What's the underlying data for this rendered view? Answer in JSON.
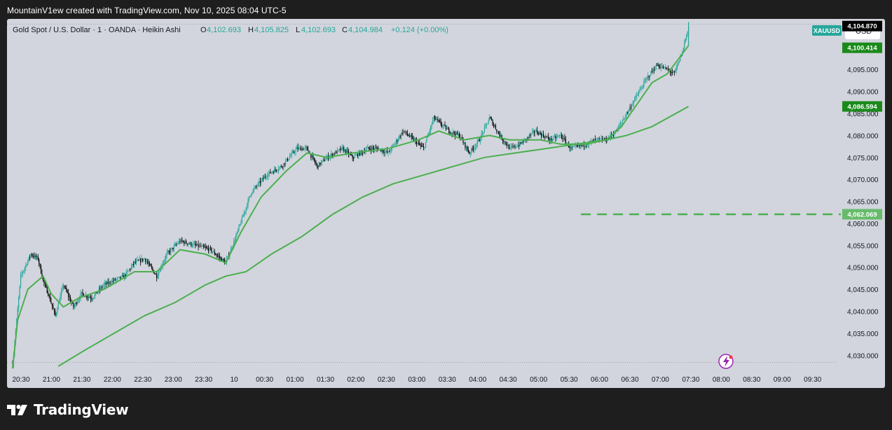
{
  "caption": "MountainV1ew created with TradingView.com, Nov 10, 2025 08:04 UTC-5",
  "brand": {
    "name": "TradingView",
    "icon": "tradingview-logo-icon"
  },
  "colors": {
    "background": "#1e1e1e",
    "plot": "#d2d5dd",
    "up": "#26a69a",
    "down": "#000000",
    "ma_fast": "#4caf50",
    "ma_slow": "#4caf50",
    "dashed_line": "#4caf50",
    "last_price_label": "#000000",
    "ma_label": "#1b8a1b",
    "dashed_label": "#66bb6a",
    "symbol_badge": "#26a69a"
  },
  "chart_data": {
    "type": "candlestick",
    "title": "Gold Spot / U.S. Dollar · 1 · OANDA · Heikin Ashi",
    "symbol": "XAUUSD",
    "currency": "USD",
    "ohlc": {
      "O": "4,102.693",
      "H": "4,105.825",
      "L": "4,102.693",
      "C": "4,104.984",
      "change": "+0.124 (+0.00%)"
    },
    "x_tick_labels": [
      "20:30",
      "21:00",
      "21:30",
      "22:00",
      "22:30",
      "23:00",
      "23:30",
      "10",
      "00:30",
      "01:00",
      "01:30",
      "02:00",
      "02:30",
      "03:00",
      "03:30",
      "04:00",
      "04:30",
      "05:00",
      "05:30",
      "06:00",
      "06:30",
      "07:00",
      "07:30",
      "08:00",
      "08:30",
      "09:00",
      "09:30"
    ],
    "y_tick_labels": [
      "4,095.000",
      "4,090.000",
      "4,085.000",
      "4,080.000",
      "4,075.000",
      "4,070.000",
      "4,065.000",
      "4,060.000",
      "4,055.000",
      "4,050.000",
      "4,045.000",
      "4,040.000",
      "4,035.000",
      "4,030.000"
    ],
    "ylim": [
      4027.5,
      4106.5
    ],
    "price_labels": [
      {
        "value": 4104.87,
        "text": "4,104.870",
        "kind": "last_price"
      },
      {
        "value": 4100.414,
        "text": "4,100.414",
        "kind": "ma_fast"
      },
      {
        "value": 4086.594,
        "text": "4,086.594",
        "kind": "ma_slow"
      },
      {
        "value": 4062.069,
        "text": "4,062.069",
        "kind": "dashed_line"
      }
    ],
    "dashed_line": {
      "value": 4062.069,
      "from_time": "05:50"
    },
    "price_path": [
      [
        "20:30",
        4028
      ],
      [
        "20:38",
        4048
      ],
      [
        "20:48",
        4053
      ],
      [
        "20:55",
        4052
      ],
      [
        "21:00",
        4047
      ],
      [
        "21:05",
        4044
      ],
      [
        "21:12",
        4039
      ],
      [
        "21:20",
        4046
      ],
      [
        "21:30",
        4041
      ],
      [
        "21:38",
        4044
      ],
      [
        "21:48",
        4043
      ],
      [
        "22:00",
        4046
      ],
      [
        "22:10",
        4047
      ],
      [
        "22:20",
        4048
      ],
      [
        "22:30",
        4051
      ],
      [
        "22:40",
        4052
      ],
      [
        "22:52",
        4048
      ],
      [
        "23:02",
        4053
      ],
      [
        "23:15",
        4056
      ],
      [
        "23:30",
        4055
      ],
      [
        "23:45",
        4054
      ],
      [
        "23:55",
        4052
      ],
      [
        "24:00",
        4051
      ],
      [
        "24:10",
        4057
      ],
      [
        "24:25",
        4067
      ],
      [
        "24:40",
        4071
      ],
      [
        "24:55",
        4073
      ],
      [
        "25:10",
        4077
      ],
      [
        "25:20",
        4077
      ],
      [
        "25:30",
        4073
      ],
      [
        "25:40",
        4075
      ],
      [
        "25:55",
        4077
      ],
      [
        "26:05",
        4075
      ],
      [
        "26:20",
        4077
      ],
      [
        "26:30",
        4077
      ],
      [
        "26:40",
        4076
      ],
      [
        "26:55",
        4081
      ],
      [
        "27:05",
        4079
      ],
      [
        "27:15",
        4077
      ],
      [
        "27:25",
        4084
      ],
      [
        "27:40",
        4081
      ],
      [
        "27:50",
        4080
      ],
      [
        "28:00",
        4076
      ],
      [
        "28:10",
        4079
      ],
      [
        "28:20",
        4084
      ],
      [
        "28:30",
        4080
      ],
      [
        "28:40",
        4077
      ],
      [
        "28:50",
        4078
      ],
      [
        "29:05",
        4081
      ],
      [
        "29:20",
        4079
      ],
      [
        "29:30",
        4080
      ],
      [
        "29:40",
        4077
      ],
      [
        "29:55",
        4078
      ],
      [
        "30:05",
        4079
      ],
      [
        "30:15",
        4079
      ],
      [
        "30:25",
        4081
      ],
      [
        "30:35",
        4085
      ],
      [
        "30:45",
        4089
      ],
      [
        "30:55",
        4093
      ],
      [
        "31:05",
        4096
      ],
      [
        "31:15",
        4095
      ],
      [
        "31:22",
        4094
      ],
      [
        "31:30",
        4099
      ],
      [
        "31:36",
        4104.984
      ]
    ],
    "ma_fast_path": [
      [
        "20:30",
        4027
      ],
      [
        "20:35",
        4038
      ],
      [
        "20:45",
        4045
      ],
      [
        "21:00",
        4048
      ],
      [
        "21:08",
        4044
      ],
      [
        "21:20",
        4041
      ],
      [
        "21:35",
        4043
      ],
      [
        "22:00",
        4045
      ],
      [
        "22:15",
        4047
      ],
      [
        "22:30",
        4049
      ],
      [
        "22:52",
        4049
      ],
      [
        "23:15",
        4054
      ],
      [
        "23:40",
        4053
      ],
      [
        "24:00",
        4051
      ],
      [
        "24:15",
        4058
      ],
      [
        "24:35",
        4066
      ],
      [
        "25:00",
        4072
      ],
      [
        "25:20",
        4076
      ],
      [
        "25:40",
        4075
      ],
      [
        "26:05",
        4076
      ],
      [
        "26:40",
        4077
      ],
      [
        "27:10",
        4079
      ],
      [
        "27:30",
        4081
      ],
      [
        "27:55",
        4079
      ],
      [
        "28:20",
        4080
      ],
      [
        "28:40",
        4079
      ],
      [
        "29:10",
        4079
      ],
      [
        "29:30",
        4078
      ],
      [
        "29:55",
        4078
      ],
      [
        "30:15",
        4079
      ],
      [
        "30:30",
        4082
      ],
      [
        "30:45",
        4087
      ],
      [
        "31:00",
        4092
      ],
      [
        "31:15",
        4094
      ],
      [
        "31:36",
        4100.414
      ]
    ],
    "ma_slow_path": [
      [
        "21:15",
        4027.5
      ],
      [
        "21:40",
        4031
      ],
      [
        "22:10",
        4035
      ],
      [
        "22:40",
        4039
      ],
      [
        "23:10",
        4042
      ],
      [
        "23:40",
        4046
      ],
      [
        "24:00",
        4048
      ],
      [
        "24:20",
        4049
      ],
      [
        "24:45",
        4053
      ],
      [
        "25:15",
        4057
      ],
      [
        "25:45",
        4062
      ],
      [
        "26:15",
        4066
      ],
      [
        "26:45",
        4069
      ],
      [
        "27:15",
        4071
      ],
      [
        "27:45",
        4073
      ],
      [
        "28:15",
        4075
      ],
      [
        "28:45",
        4076
      ],
      [
        "29:15",
        4077
      ],
      [
        "29:45",
        4078
      ],
      [
        "30:15",
        4079
      ],
      [
        "30:35",
        4080
      ],
      [
        "31:00",
        4082
      ],
      [
        "31:36",
        4086.594
      ]
    ]
  }
}
